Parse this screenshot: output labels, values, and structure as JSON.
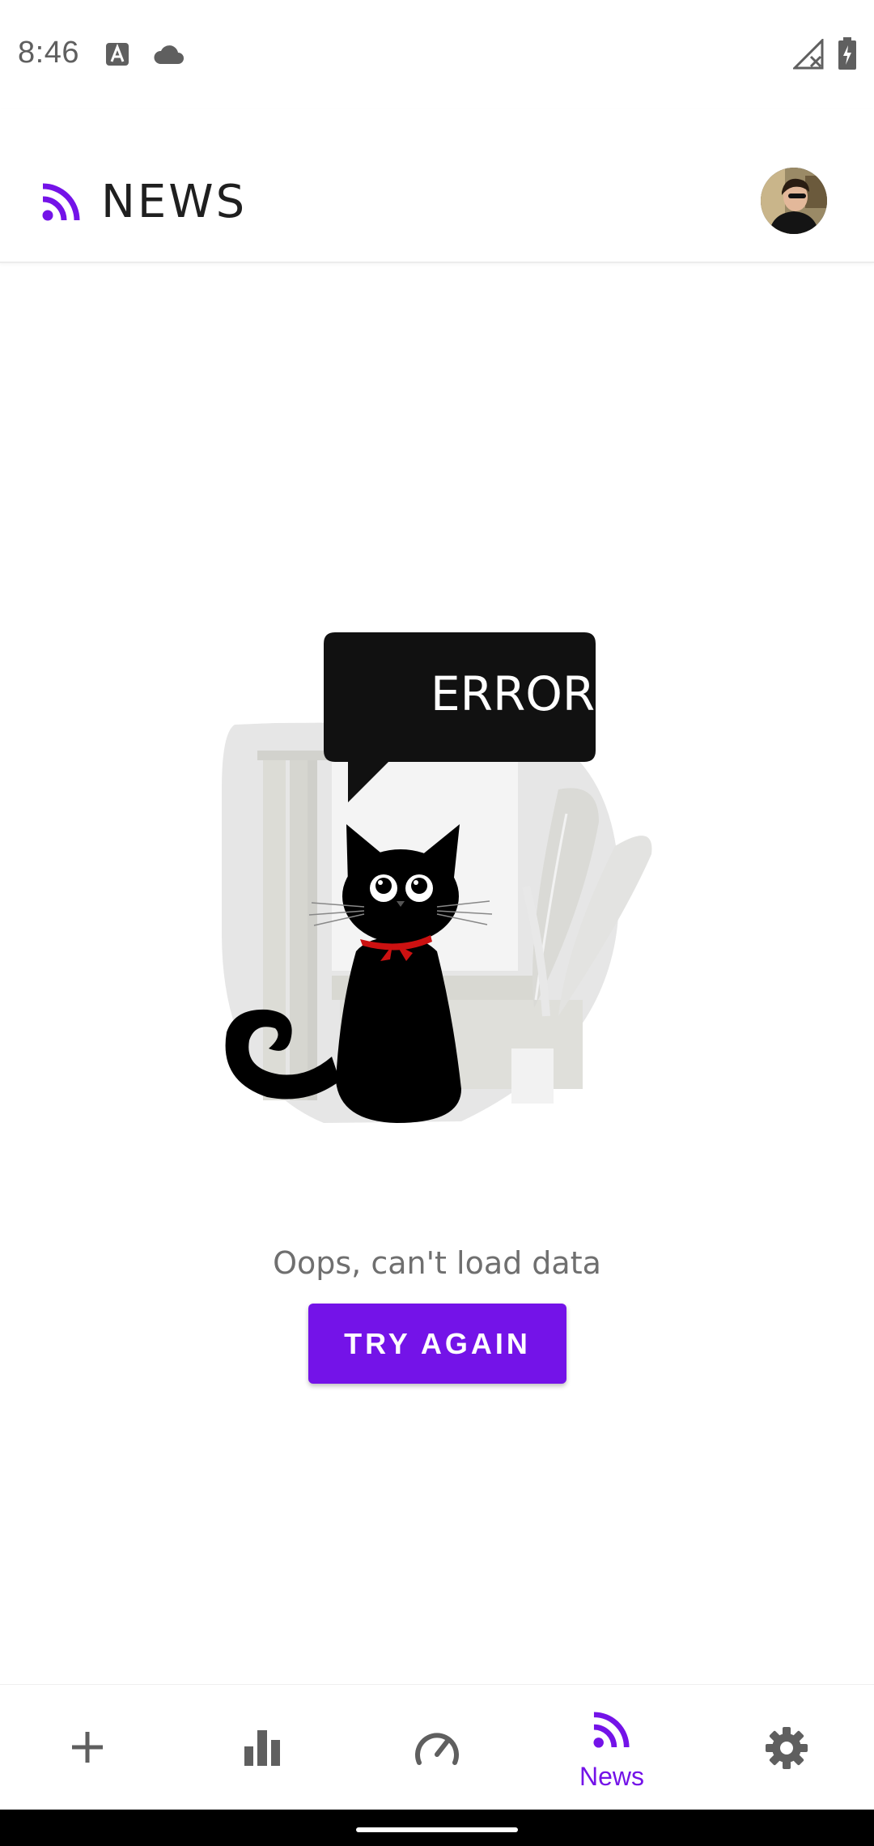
{
  "status_bar": {
    "time": "8:46",
    "icons": [
      "font-notification-icon",
      "cloud-icon",
      "signal-off-icon",
      "battery-charging-icon"
    ]
  },
  "app_bar": {
    "title": "NEWS",
    "title_icon": "rss-feed-icon",
    "avatar": "user-avatar"
  },
  "illustration": {
    "speech_bubble_text": "ERROR",
    "subject": "black-cat-icon"
  },
  "error": {
    "message": "Oops, can't load data",
    "retry_label": "TRY AGAIN"
  },
  "bottom_nav": {
    "items": [
      {
        "icon": "add-icon",
        "label": ""
      },
      {
        "icon": "bar-chart-icon",
        "label": ""
      },
      {
        "icon": "speedometer-icon",
        "label": ""
      },
      {
        "icon": "rss-feed-icon",
        "label": "News",
        "selected": true
      },
      {
        "icon": "gear-icon",
        "label": ""
      }
    ]
  },
  "colors": {
    "accent": "#7413e8",
    "icon_gray": "#5f5f5f",
    "text_gray": "#6f6f6f"
  }
}
